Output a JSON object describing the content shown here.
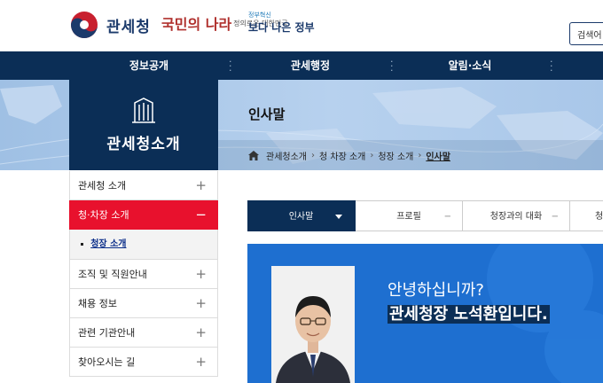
{
  "header": {
    "logo_text": "관세청",
    "slogan_main": "국민의 나라",
    "slogan_sub": "정의로운 대한민국",
    "gov_top": "정부혁신",
    "gov_bottom": "보다 나은 정부",
    "search_label": "검색어"
  },
  "gnb": {
    "items": [
      "정보공개",
      "관세행정",
      "알림·소식"
    ]
  },
  "section_title": "관세청소개",
  "page_title": "인사말",
  "breadcrumb": [
    "관세청소개",
    "청 차장 소개",
    "청장 소개",
    "인사말"
  ],
  "lnb": {
    "items": [
      {
        "label": "관세청 소개",
        "state": "+"
      },
      {
        "label": "청·차장 소개",
        "state": "−"
      },
      {
        "label": "조직 및 직원안내",
        "state": "+"
      },
      {
        "label": "채용 정보",
        "state": "+"
      },
      {
        "label": "관련 기관안내",
        "state": "+"
      },
      {
        "label": "찾아오시는 길",
        "state": "+"
      }
    ],
    "sub_item": "청장 소개"
  },
  "tabs": [
    {
      "label": "인사말"
    },
    {
      "label": "프로필"
    },
    {
      "label": "청장과의 대화"
    },
    {
      "label": "청"
    }
  ],
  "greeting": {
    "line1": "안녕하십니까?",
    "line2_prefix": "관세청장 ",
    "line2_name": "노석환",
    "line2_suffix": "입니다."
  },
  "colors": {
    "navy": "#0b2e56",
    "red": "#e8112d",
    "banner_blue": "#1e6fd0"
  }
}
